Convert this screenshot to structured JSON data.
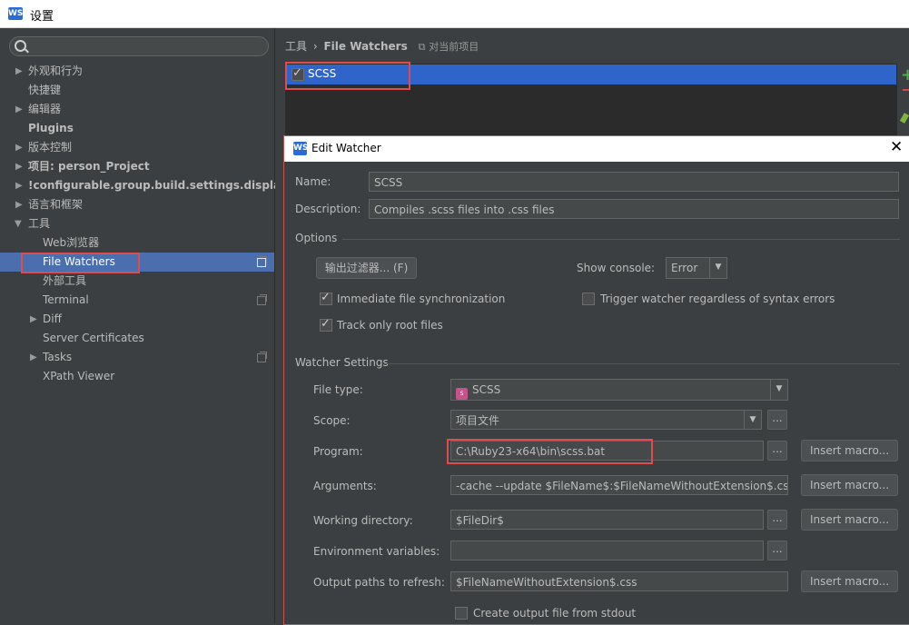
{
  "window": {
    "title": "设置",
    "logo": "WS"
  },
  "search": {
    "placeholder": ""
  },
  "tree": [
    {
      "label": "外观和行为",
      "arrow": "▶"
    },
    {
      "label": "快捷键",
      "arrow": ""
    },
    {
      "label": "编辑器",
      "arrow": "▶"
    },
    {
      "label": "Plugins",
      "arrow": ""
    },
    {
      "label": "版本控制",
      "arrow": "▶"
    },
    {
      "label": "项目: person_Project",
      "arrow": "▶"
    },
    {
      "label": "!configurable.group.build.settings.displa...",
      "arrow": "▶"
    },
    {
      "label": "语言和框架",
      "arrow": "▶"
    },
    {
      "label": "工具",
      "arrow": "▼"
    },
    {
      "label": "Web浏览器",
      "arrow": ""
    },
    {
      "label": "File Watchers",
      "arrow": ""
    },
    {
      "label": "外部工具",
      "arrow": ""
    },
    {
      "label": "Terminal",
      "arrow": ""
    },
    {
      "label": "Diff",
      "arrow": "▶"
    },
    {
      "label": "Server Certificates",
      "arrow": ""
    },
    {
      "label": "Tasks",
      "arrow": "▶"
    },
    {
      "label": "XPath Viewer",
      "arrow": ""
    }
  ],
  "breadcrumb": {
    "parent": "工具",
    "separator": "›",
    "current": "File Watchers",
    "note": "对当前项目"
  },
  "watchers": [
    {
      "name": "SCSS",
      "enabled": true
    }
  ],
  "dialog": {
    "title": "Edit Watcher",
    "name_label": "Name:",
    "name_value": "SCSS",
    "description_label": "Description:",
    "description_value": "Compiles .scss files into .css files",
    "options_section": "Options",
    "filter_button": "输出过滤器... (F)",
    "show_console_label": "Show console:",
    "show_console_value": "Error",
    "immediate_sync": "Immediate file synchronization",
    "trigger_regardless": "Trigger watcher regardless of syntax errors",
    "track_root": "Track only root files",
    "watcher_settings_section": "Watcher Settings",
    "file_type_label": "File type:",
    "file_type_value": "SCSS",
    "scope_label": "Scope:",
    "scope_value": "项目文件",
    "program_label": "Program:",
    "program_value": "C:\\Ruby23-x64\\bin\\scss.bat",
    "arguments_label": "Arguments:",
    "arguments_value": "-cache --update $FileName$:$FileNameWithoutExtension$.css",
    "working_dir_label": "Working directory:",
    "working_dir_value": "$FileDir$",
    "env_label": "Environment variables:",
    "env_value": "",
    "output_paths_label": "Output paths to refresh:",
    "output_paths_value": "$FileNameWithoutExtension$.css",
    "insert_macro": "Insert macro...",
    "dots": "...",
    "create_output": "Create output file from stdout"
  }
}
